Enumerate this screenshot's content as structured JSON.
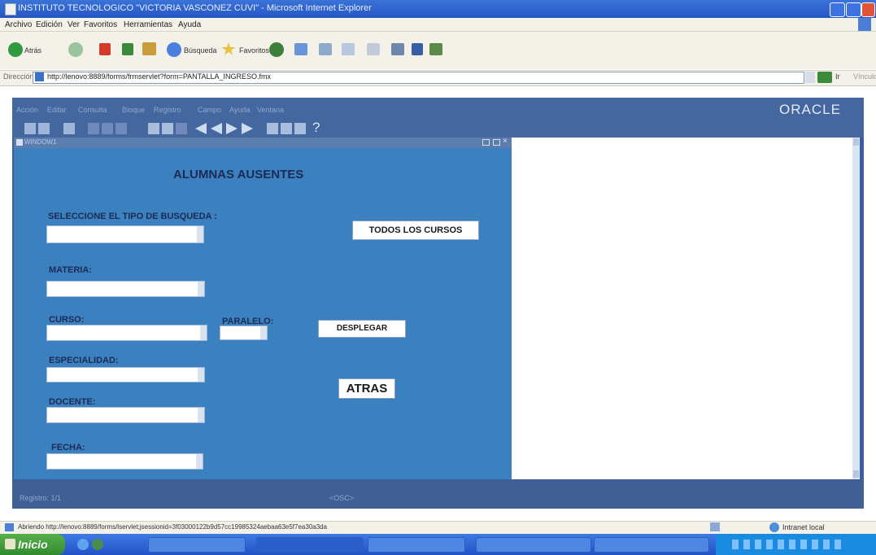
{
  "browser": {
    "title": "INSTITUTO TECNOLOGICO \"VICTORIA VASCONEZ CUVI\" - Microsoft Internet Explorer",
    "menu": [
      "Archivo",
      "Edición",
      "Ver",
      "Favoritos",
      "Herramientas",
      "Ayuda"
    ],
    "toolbar": {
      "back_label": "Atrás",
      "search_label": "Búsqueda",
      "favorites_label": "Favoritos"
    },
    "address_label": "Dirección",
    "address_url": "http://lenovo:8889/forms/frmservlet?form=PANTALLA_INGRESO.fmx",
    "go_label": "Ir",
    "links_label": "Vínculos",
    "status_text": "Abriendo http://lenovo:8889/forms/lservlet;jsessionid=3f03000122b9d57cc19985324aebaa63e5f7ea30a3da",
    "zone_label": "Intranet local"
  },
  "forms": {
    "menu": [
      "Acción",
      "Editar",
      "Consulta",
      "Bloque",
      "Registro",
      "Campo",
      "Ayuda",
      "Ventana"
    ],
    "brand": "ORACLE",
    "window_title": "WINDOW1",
    "status_record": "Registro: 1/1",
    "status_osc": "<OSC>"
  },
  "screen": {
    "heading": "ALUMNAS AUSENTES",
    "search_type_label": "SELECCIONE EL TIPO DE BUSQUEDA :",
    "search_type_value": "",
    "materia_label": "MATERIA:",
    "curso_label": "CURSO:",
    "paralelo_label": "PARALELO:",
    "especialidad_label": "ESPECIALIDAD:",
    "docente_label": "DOCENTE:",
    "fecha_label": "FECHA:",
    "btn_todos": "TODOS LOS CURSOS",
    "btn_desplegar": "DESPLEGAR",
    "btn_atras": "ATRAS"
  },
  "taskbar": {
    "start_label": "Inicio"
  },
  "colors": {
    "forms_background": "#3b81bf",
    "forms_shell": "#3c5e9a",
    "taskbar": "#2351c7",
    "start_button": "#3e9a3a"
  }
}
